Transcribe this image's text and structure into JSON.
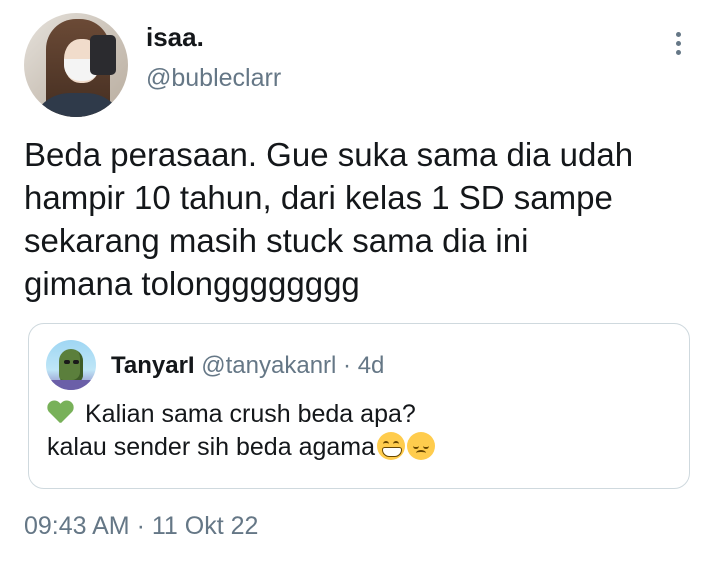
{
  "tweet": {
    "display_name": "isaa.",
    "handle": "@bubleclarr",
    "text": "Beda perasaan. Gue suka sama dia udah\nhampir 10 tahun, dari kelas 1 SD sampe\nsekarang masih stuck sama dia ini\ngimana tolongggggggg",
    "timestamp": "09:43 AM · 11 Okt 22"
  },
  "quoted_tweet": {
    "display_name": "TanyarI",
    "handle": "@tanyakanrl",
    "age": "· 4d",
    "line1": "Kalian sama crush beda apa?",
    "line2": "kalau sender sih beda agama",
    "icons": [
      "green-heart-emoji",
      "grinning-emoji",
      "pensive-emoji"
    ]
  },
  "colors": {
    "text": "#14171a",
    "secondary_text": "#657786",
    "border": "#cfd9de"
  }
}
